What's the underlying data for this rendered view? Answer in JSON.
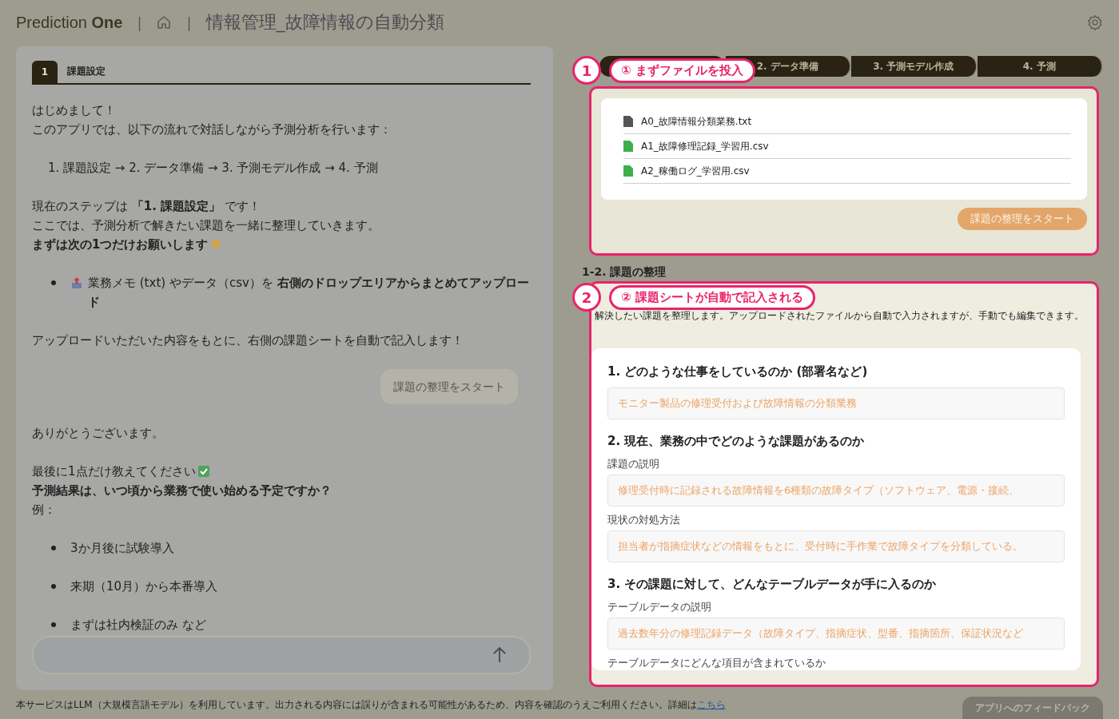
{
  "header": {
    "logo": "Prediction **One**",
    "separator_1": "|",
    "separator_2": "|",
    "title": "情報管理_故障情報の自動分類"
  },
  "chat": {
    "tab_number": "1",
    "tab_label": "課題設定",
    "blocks": [
      {
        "kind": "para",
        "lines": [
          "はじめまして！",
          "このアプリでは、以下の流れで対話しながら予測分析を行います："
        ]
      },
      {
        "kind": "indent",
        "lines": [
          "1. 課題設定 → 2. データ準備 → 3. 予測モデル作成 → 4. 予測"
        ]
      },
      {
        "kind": "para-point",
        "lines": [
          "現在のステップは **「1. 課題設定」** です！",
          "ここでは、予測分析で解きたい課題を一緒に整理していきます。",
          "**まずは次の1つだけお願いします**"
        ]
      },
      {
        "kind": "upload-bullets",
        "lines": [
          "業務メモ (txt) やデータ（csv）を **右側のドロップエリアからまとめてアップロード**"
        ]
      },
      {
        "kind": "para",
        "lines": [
          "アップロードいただいた内容をもとに、右側の課題シートを自動で記入します！"
        ]
      },
      {
        "kind": "user",
        "lines": [
          "課題の整理をスタート"
        ]
      },
      {
        "kind": "para",
        "lines": [
          "ありがとうございます。"
        ]
      },
      {
        "kind": "para-check",
        "lines": [
          "最後に1点だけ教えてください",
          "**予測結果は、いつ頃から業務で使い始める予定ですか？**",
          "例："
        ]
      },
      {
        "kind": "bullets",
        "lines": [
          "3か月後に試験導入",
          "来期（10月）から本番導入",
          "まずは社内検証のみ など"
        ]
      }
    ]
  },
  "steps": [
    {
      "label": "2. データ準備"
    },
    {
      "label": "3. 予測モデル作成"
    },
    {
      "label": "4. 予測"
    }
  ],
  "callouts": [
    {
      "number": "1",
      "text": "① まずファイルを投入"
    },
    {
      "number": "2",
      "text": "② 課題シートが自動で記入される"
    }
  ],
  "files": [
    {
      "name": "A0_故障情報分類業務.txt",
      "color": "#555555"
    },
    {
      "name": "A1_故障修理記録_学習用.csv",
      "color": "#3fae49"
    },
    {
      "name": "A2_稼働ログ_学習用.csv",
      "color": "#3fae49"
    }
  ],
  "start_button": "課題の整理をスタート",
  "sheet": {
    "heading": "1-2. 課題の整理",
    "description": "解決したい課題を整理します。アップロードされたファイルから自動で入力されますが、手動でも編集できます。",
    "sections": [
      {
        "title": "1. どのような仕事をしているのか (部署名など)",
        "fields": [
          {
            "value": "モニター製品の修理受付および故障情報の分類業務"
          }
        ]
      },
      {
        "title": "2. 現在、業務の中でどのような課題があるのか",
        "fields": [
          {
            "label": "課題の説明",
            "value": "修理受付時に記録される故障情報を6種類の故障タイプ（ソフトウェア、電源・接続、"
          },
          {
            "label": "現状の対処方法",
            "value": "担当者が指摘症状などの情報をもとに、受付時に手作業で故障タイプを分類している。"
          }
        ]
      },
      {
        "title": "3. その課題に対して、どんなテーブルデータが手に入るのか",
        "fields": [
          {
            "label": "テーブルデータの説明",
            "value": "過去数年分の修理記録データ（故障タイプ、指摘症状、型番、指摘箇所、保証状況など"
          },
          {
            "label": "テーブルデータにどんな項目が含まれているか"
          }
        ]
      }
    ]
  },
  "footer": {
    "notice": "本サービスはLLM（大規模言語モデル）を利用しています。出力される内容には誤りが含まれる可能性があるため、内容を確認のうえご利用ください。詳細は",
    "link": "こちら",
    "feedback": "アプリへのフィードバック"
  }
}
